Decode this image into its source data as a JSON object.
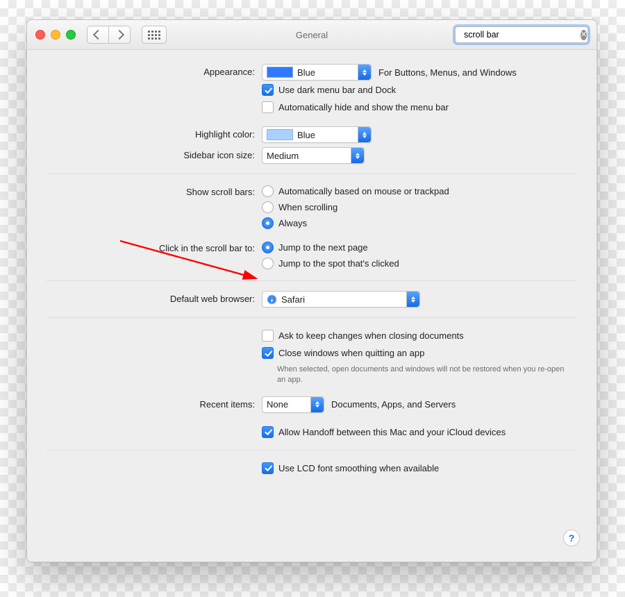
{
  "window": {
    "title": "General"
  },
  "search": {
    "value": "scroll bar"
  },
  "appearance": {
    "label": "Appearance:",
    "value": "Blue",
    "swatch_color": "#2f79ff",
    "caption": "For Buttons, Menus, and Windows",
    "dark_menu": {
      "label": "Use dark menu bar and Dock",
      "checked": true
    },
    "auto_hide_menu": {
      "label": "Automatically hide and show the menu bar",
      "checked": false
    }
  },
  "highlight": {
    "label": "Highlight color:",
    "value": "Blue",
    "swatch_color": "#a9d1ff"
  },
  "sidebar_size": {
    "label": "Sidebar icon size:",
    "value": "Medium"
  },
  "scrollbars": {
    "label": "Show scroll bars:",
    "options": [
      {
        "label": "Automatically based on mouse or trackpad",
        "selected": false
      },
      {
        "label": "When scrolling",
        "selected": false
      },
      {
        "label": "Always",
        "selected": true
      }
    ]
  },
  "scroll_click": {
    "label": "Click in the scroll bar to:",
    "options": [
      {
        "label": "Jump to the next page",
        "selected": true
      },
      {
        "label": "Jump to the spot that's clicked",
        "selected": false
      }
    ]
  },
  "browser": {
    "label": "Default web browser:",
    "value": "Safari"
  },
  "docs": {
    "ask_keep": {
      "label": "Ask to keep changes when closing documents",
      "checked": false
    },
    "close_windows": {
      "label": "Close windows when quitting an app",
      "checked": true
    },
    "close_hint": "When selected, open documents and windows will not be restored when you re-open an app."
  },
  "recent": {
    "label": "Recent items:",
    "value": "None",
    "caption": "Documents, Apps, and Servers"
  },
  "handoff": {
    "label": "Allow Handoff between this Mac and your iCloud devices",
    "checked": true
  },
  "lcd": {
    "label": "Use LCD font smoothing when available",
    "checked": true
  },
  "help": "?"
}
